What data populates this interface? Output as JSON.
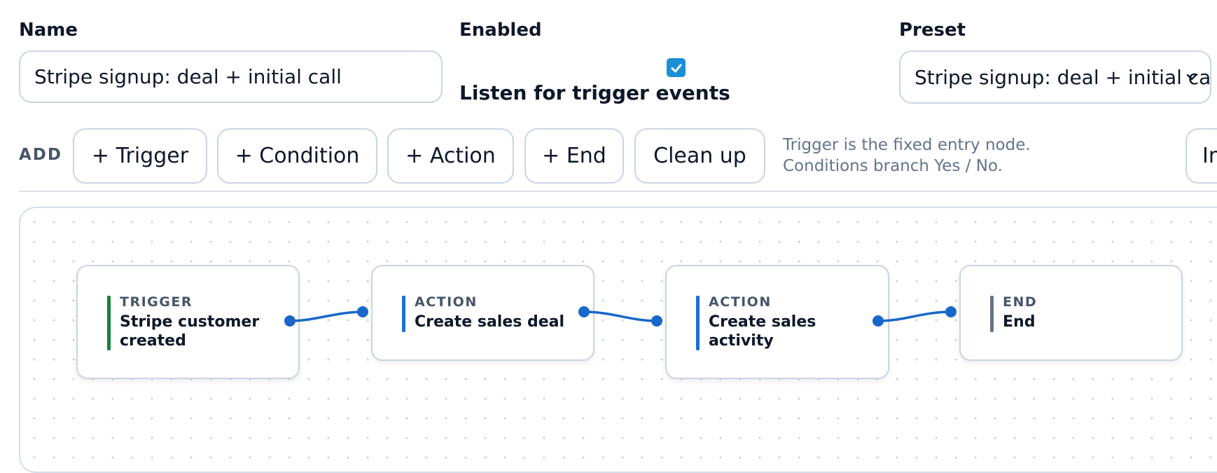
{
  "form": {
    "name_label": "Name",
    "name_value": "Stripe signup: deal + initial call",
    "enabled_label": "Enabled",
    "listen_label": "Listen for trigger events",
    "preset_label": "Preset",
    "preset_value": "Stripe signup: deal + initial call"
  },
  "toolbar": {
    "add_label": "ADD",
    "buttons": [
      "+ Trigger",
      "+ Condition",
      "+ Action",
      "+ End",
      "Clean up"
    ],
    "hint": "Trigger is the fixed entry node. Conditions branch Yes / No.",
    "partial_button": "Import"
  },
  "nodes": [
    {
      "kind": "TRIGGER",
      "title": "Stripe customer created",
      "accent": "#15803d"
    },
    {
      "kind": "ACTION",
      "title": "Create sales deal",
      "accent": "#1d6fd1"
    },
    {
      "kind": "ACTION",
      "title": "Create sales activity",
      "accent": "#1d6fd1"
    },
    {
      "kind": "END",
      "title": "End",
      "accent": "#64748b"
    }
  ],
  "colors": {
    "edge": "#1967c9",
    "checkbox": "#1a8fd6"
  }
}
